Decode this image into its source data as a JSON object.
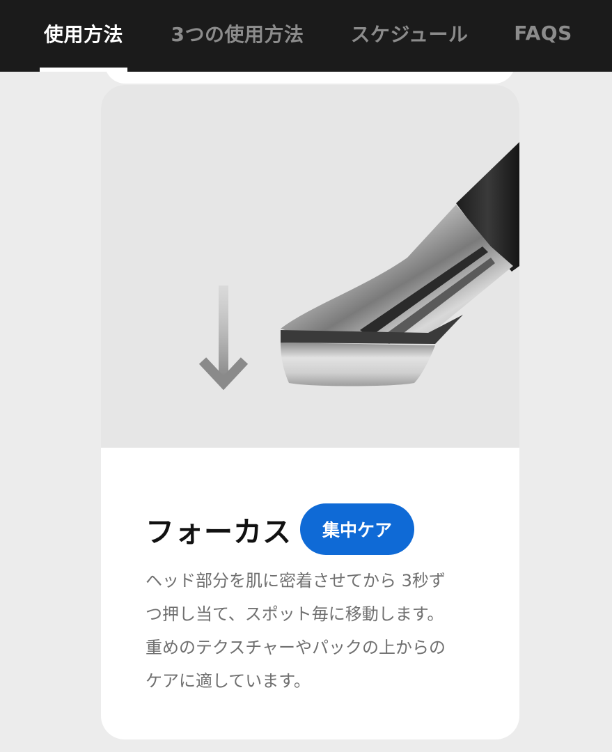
{
  "nav": {
    "tabs": [
      {
        "label": "使用方法",
        "active": true
      },
      {
        "label": "3つの使用方法",
        "active": false
      },
      {
        "label": "スケジュール",
        "active": false
      },
      {
        "label": "FAQS",
        "active": false
      }
    ]
  },
  "card": {
    "title": "フォーカス",
    "badge": "集中ケア",
    "description_lines": [
      "ヘッド部分を肌に密着させてから 3秒ず",
      "つ押し当て、スポット毎に移動します。",
      "重めのテクスチャーやパックの上からの",
      "ケアに適しています。"
    ],
    "image_icon": "arrow-down-icon"
  },
  "colors": {
    "nav_background": "#1b1b1b",
    "page_background": "#ececec",
    "badge_background": "#0f6ad6",
    "description_text": "#6f6f6f"
  }
}
